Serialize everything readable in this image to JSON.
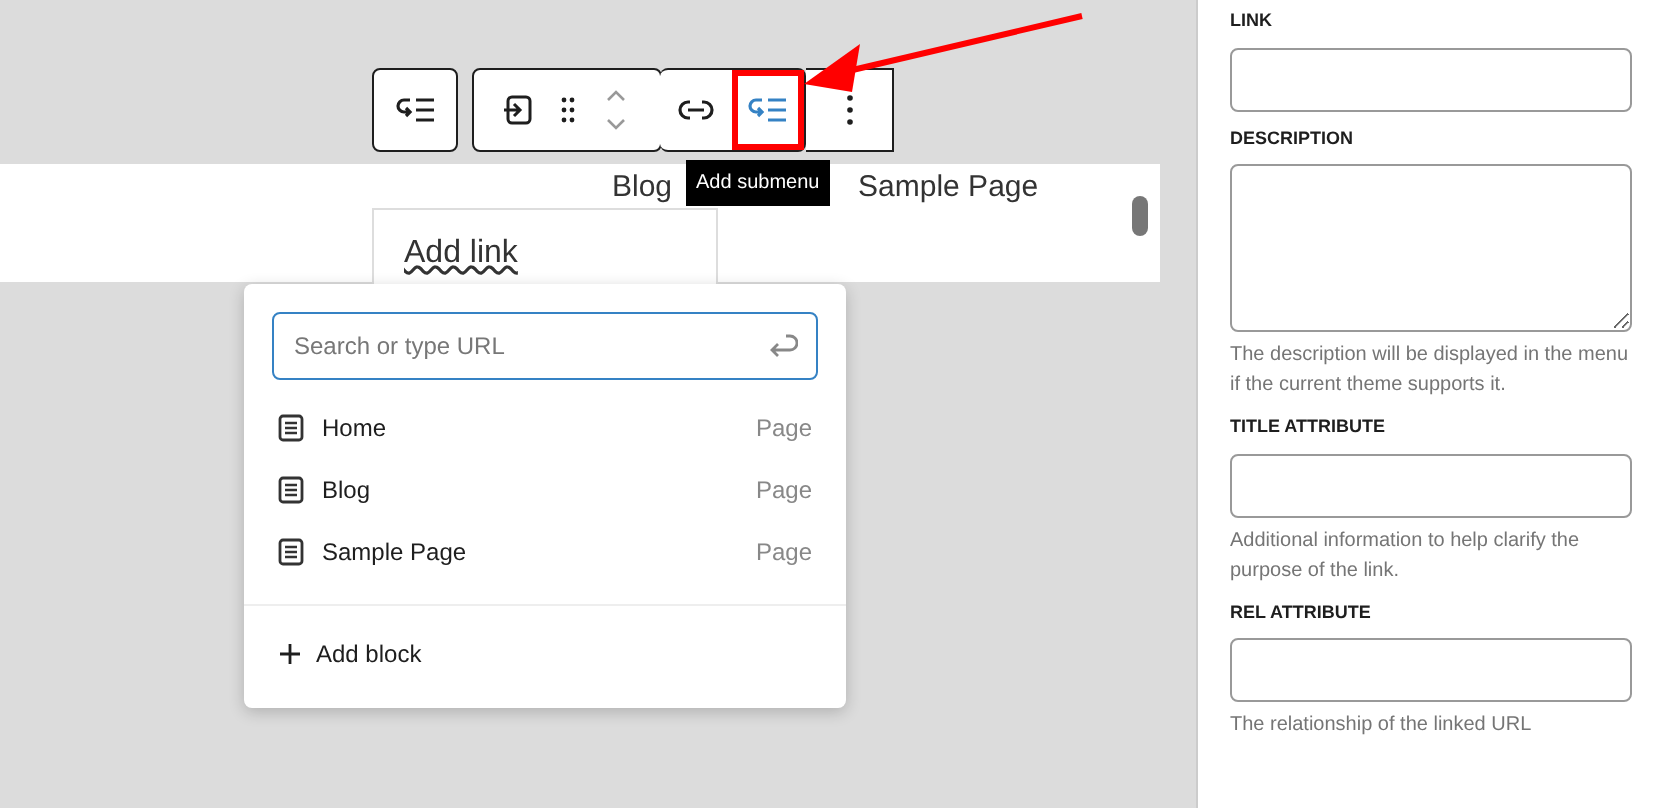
{
  "toolbar": {
    "groups": [
      {
        "buttons": [
          {
            "kind": "submenu",
            "selected": false,
            "highlighted": false
          }
        ]
      },
      {
        "buttons": [
          {
            "kind": "parent",
            "selected": false,
            "highlighted": false
          },
          {
            "kind": "drag",
            "selected": false,
            "highlighted": false
          },
          {
            "kind": "move",
            "selected": false,
            "highlighted": false
          }
        ]
      },
      {
        "buttons": [
          {
            "kind": "link",
            "selected": false,
            "highlighted": false
          },
          {
            "kind": "submenu",
            "selected": true,
            "highlighted": true
          }
        ]
      },
      {
        "buttons": [
          {
            "kind": "more",
            "selected": false,
            "highlighted": false
          }
        ]
      }
    ]
  },
  "tooltip": "Add submenu",
  "nav_items": [
    "Blog",
    "Sample Page"
  ],
  "add_link": "Add link",
  "link_popover": {
    "search": {
      "placeholder": "Search or type URL"
    },
    "results": [
      {
        "title": "Home",
        "type": "Page"
      },
      {
        "title": "Blog",
        "type": "Page"
      },
      {
        "title": "Sample Page",
        "type": "Page"
      }
    ],
    "add_block": "Add block"
  },
  "sidebar": {
    "fields": [
      {
        "label": "LINK",
        "kind": "input"
      },
      {
        "label": "DESCRIPTION",
        "kind": "textarea",
        "help": "The description will be displayed in the menu if the current theme supports it."
      },
      {
        "label": "TITLE ATTRIBUTE",
        "kind": "input",
        "help": "Additional information to help clarify the purpose of the link."
      },
      {
        "label": "REL ATTRIBUTE",
        "kind": "input",
        "help": "The relationship of the linked URL"
      }
    ]
  }
}
